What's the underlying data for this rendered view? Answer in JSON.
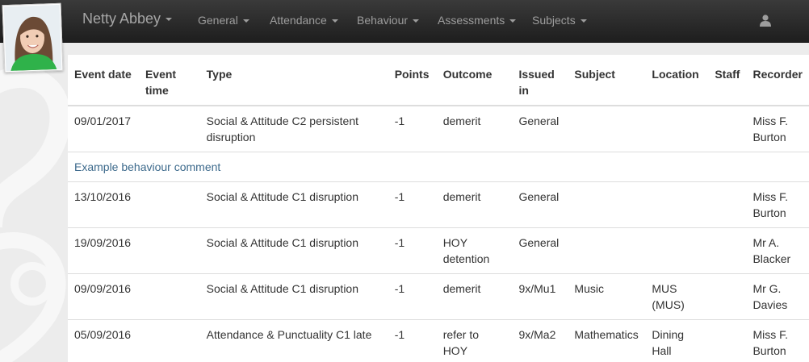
{
  "navbar": {
    "brand": "Netty Abbey",
    "menus": [
      "General",
      "Attendance",
      "Behaviour",
      "Assessments",
      "Subjects"
    ]
  },
  "table": {
    "headers": [
      "Event date",
      "Event time",
      "Type",
      "Points",
      "Outcome",
      "Issued in",
      "Subject",
      "Location",
      "Staff",
      "Recorder"
    ],
    "rows": [
      {
        "date": "09/01/2017",
        "time": "",
        "type": "Social & Attitude C2 persistent disruption",
        "points": "-1",
        "outcome": "demerit",
        "issued": "General",
        "subject": "",
        "location": "",
        "staff": "",
        "recorder": "Miss F. Burton"
      },
      {
        "comment": "Example behaviour comment"
      },
      {
        "date": "13/10/2016",
        "time": "",
        "type": "Social & Attitude C1 disruption",
        "points": "-1",
        "outcome": "demerit",
        "issued": "General",
        "subject": "",
        "location": "",
        "staff": "",
        "recorder": "Miss F. Burton"
      },
      {
        "date": "19/09/2016",
        "time": "",
        "type": "Social & Attitude C1 disruption",
        "points": "-1",
        "outcome": "HOY detention",
        "issued": "General",
        "subject": "",
        "location": "",
        "staff": "",
        "recorder": "Mr A. Blacker"
      },
      {
        "date": "09/09/2016",
        "time": "",
        "type": "Social & Attitude C1 disruption",
        "points": "-1",
        "outcome": "demerit",
        "issued": "9x/Mu1",
        "subject": "Music",
        "location": "MUS (MUS)",
        "staff": "",
        "recorder": "Mr G. Davies"
      },
      {
        "date": "05/09/2016",
        "time": "",
        "type": "Attendance & Punctuality C1 late",
        "points": "-1",
        "outcome": "refer to HOY",
        "issued": "9x/Ma2",
        "subject": "Mathematics",
        "location": "Dining Hall",
        "staff": "",
        "recorder": "Miss F. Burton"
      }
    ]
  },
  "icons": {
    "user": "user-icon",
    "avatar": "student-photo"
  },
  "colors": {
    "navbar": "#2b2b2b",
    "link": "#3d6a8c",
    "background": "#ececec"
  }
}
